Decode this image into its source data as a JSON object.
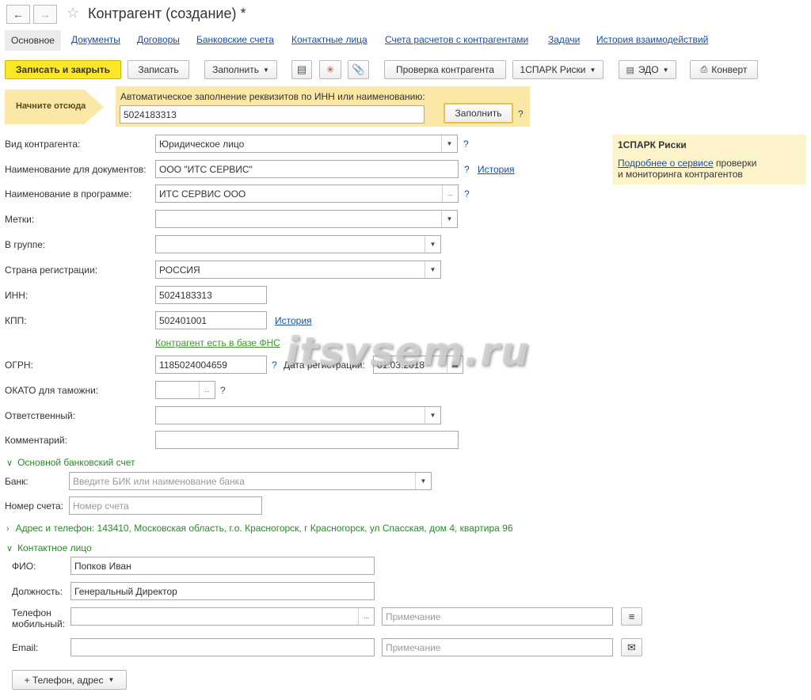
{
  "window": {
    "title": "Контрагент (создание) *"
  },
  "tabs": [
    "Основное",
    "Документы",
    "Договоры",
    "Банковские счета",
    "Контактные лица",
    "Счета расчетов с контрагентами",
    "Задачи",
    "История взаимодействий"
  ],
  "toolbar": {
    "save_close": "Записать и закрыть",
    "save": "Записать",
    "fill": "Заполнить",
    "check": "Проверка контрагента",
    "spark": "1СПАРК Риски",
    "edo": "ЭДО",
    "envelope": "Конверт"
  },
  "autofill": {
    "hint": "Начните отсюда",
    "caption": "Автоматическое заполнение реквизитов по ИНН или наименованию:",
    "value": "5024183313",
    "button": "Заполнить",
    "help": "?"
  },
  "spark_panel": {
    "title": "1СПАРК Риски",
    "link": "Подробнее о сервисе",
    "text1": " проверки",
    "text2": "и мониторинга контрагентов"
  },
  "form": {
    "kind": {
      "label": "Вид контрагента:",
      "value": "Юридическое лицо"
    },
    "doc_name": {
      "label": "Наименование для документов:",
      "value": "ООО \"ИТС СЕРВИС\"",
      "link": "История"
    },
    "prog_name": {
      "label": "Наименование в программе:",
      "value": "ИТС СЕРВИС ООО"
    },
    "tags": {
      "label": "Метки:",
      "value": ""
    },
    "group": {
      "label": "В группе:",
      "value": ""
    },
    "country": {
      "label": "Страна регистрации:",
      "value": "РОССИЯ"
    },
    "inn": {
      "label": "ИНН:",
      "value": "5024183313"
    },
    "kpp": {
      "label": "КПП:",
      "value": "502401001",
      "link": "История"
    },
    "fns": "Контрагент есть в базе ФНС",
    "ogrn": {
      "label": "ОГРН:",
      "value": "1185024004659",
      "reg_label": "Дата регистрации:",
      "reg_value": "01.03.2018"
    },
    "okato": {
      "label": "ОКАТО для таможни:",
      "value": ""
    },
    "responsible": {
      "label": "Ответственный:",
      "value": ""
    },
    "comment": {
      "label": "Комментарий:",
      "value": ""
    }
  },
  "bank": {
    "section": "Основной банковский счет",
    "bank_label": "Банк:",
    "bank_placeholder": "Введите БИК или наименование банка",
    "acc_label": "Номер счета:",
    "acc_placeholder": "Номер счета"
  },
  "address": "Адрес и телефон: 143410, Московская область, г.о. Красногорск, г Красногорск, ул Спасская, дом 4, квартира 96",
  "contact": {
    "section": "Контактное лицо",
    "fio_label": "ФИО:",
    "fio": "Попков Иван",
    "pos_label": "Должность:",
    "pos": "Генеральный Директор",
    "phone_label1": "Телефон",
    "phone_label2": "мобильный:",
    "phone": "",
    "note_placeholder": "Примечание",
    "email_label": "Email:",
    "email": "",
    "add_button": "+ Телефон, адрес"
  },
  "watermark": "itsvsem.ru"
}
